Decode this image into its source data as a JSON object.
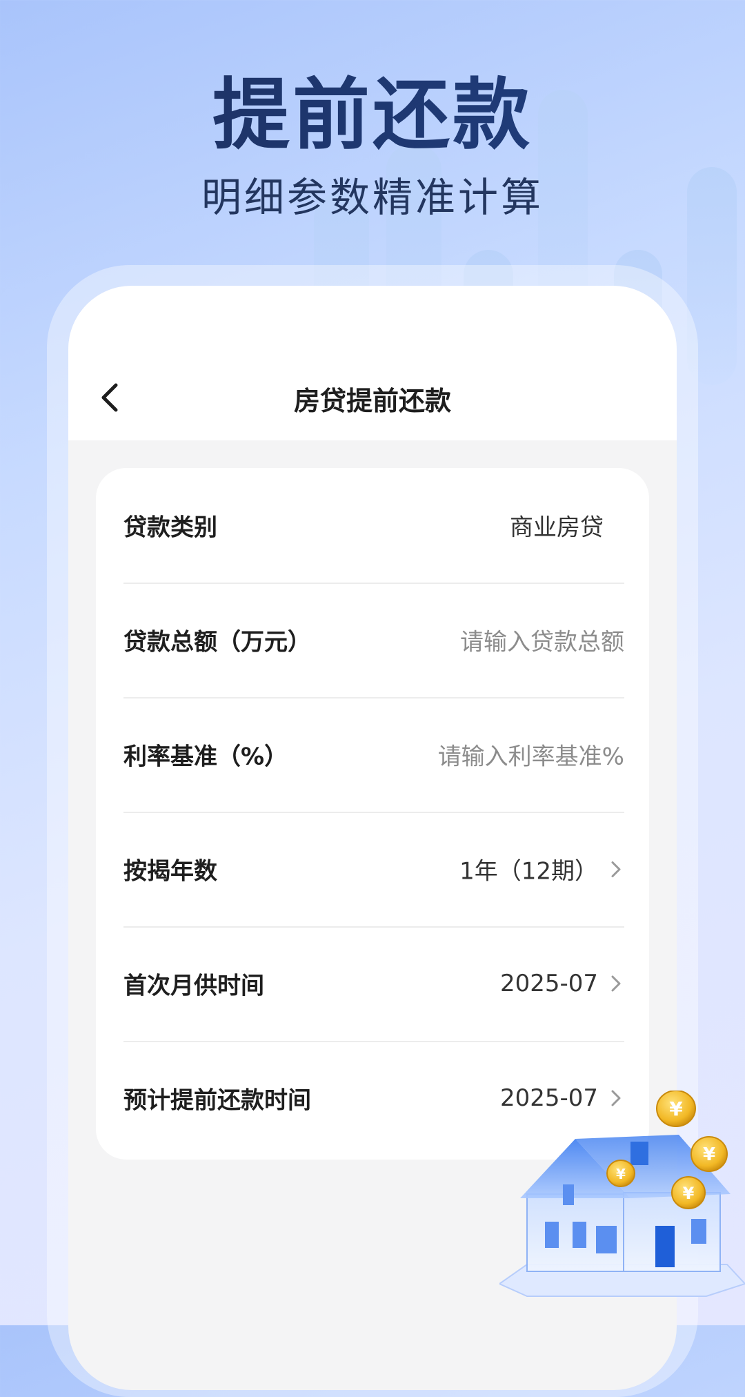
{
  "hero": {
    "title": "提前还款",
    "subtitle": "明细参数精准计算"
  },
  "nav": {
    "title": "房贷提前还款",
    "back_icon": "chevron-left-icon"
  },
  "form": {
    "rows": [
      {
        "label": "贷款类别",
        "value": "商业房贷",
        "type": "select"
      },
      {
        "label": "贷款总额（万元）",
        "placeholder": "请输入贷款总额",
        "type": "input"
      },
      {
        "label": "利率基准（%）",
        "placeholder": "请输入利率基准%",
        "type": "input"
      },
      {
        "label": "按揭年数",
        "value": "1年（12期）",
        "type": "picker"
      },
      {
        "label": "首次月供时间",
        "value": "2025-07",
        "type": "picker"
      },
      {
        "label": "预计提前还款时间",
        "value": "2025-07",
        "type": "picker"
      }
    ]
  },
  "decoration": {
    "house_icon": "house-with-coins-icon",
    "coin_symbol": "¥"
  },
  "colors": {
    "title_dark": "#1f3669",
    "accent_blue": "#2f74d6",
    "card_bg": "#ffffff",
    "screen_bg": "#f4f4f5",
    "placeholder_gray": "#8c8c8c",
    "coin_gold": "#f2b825"
  }
}
